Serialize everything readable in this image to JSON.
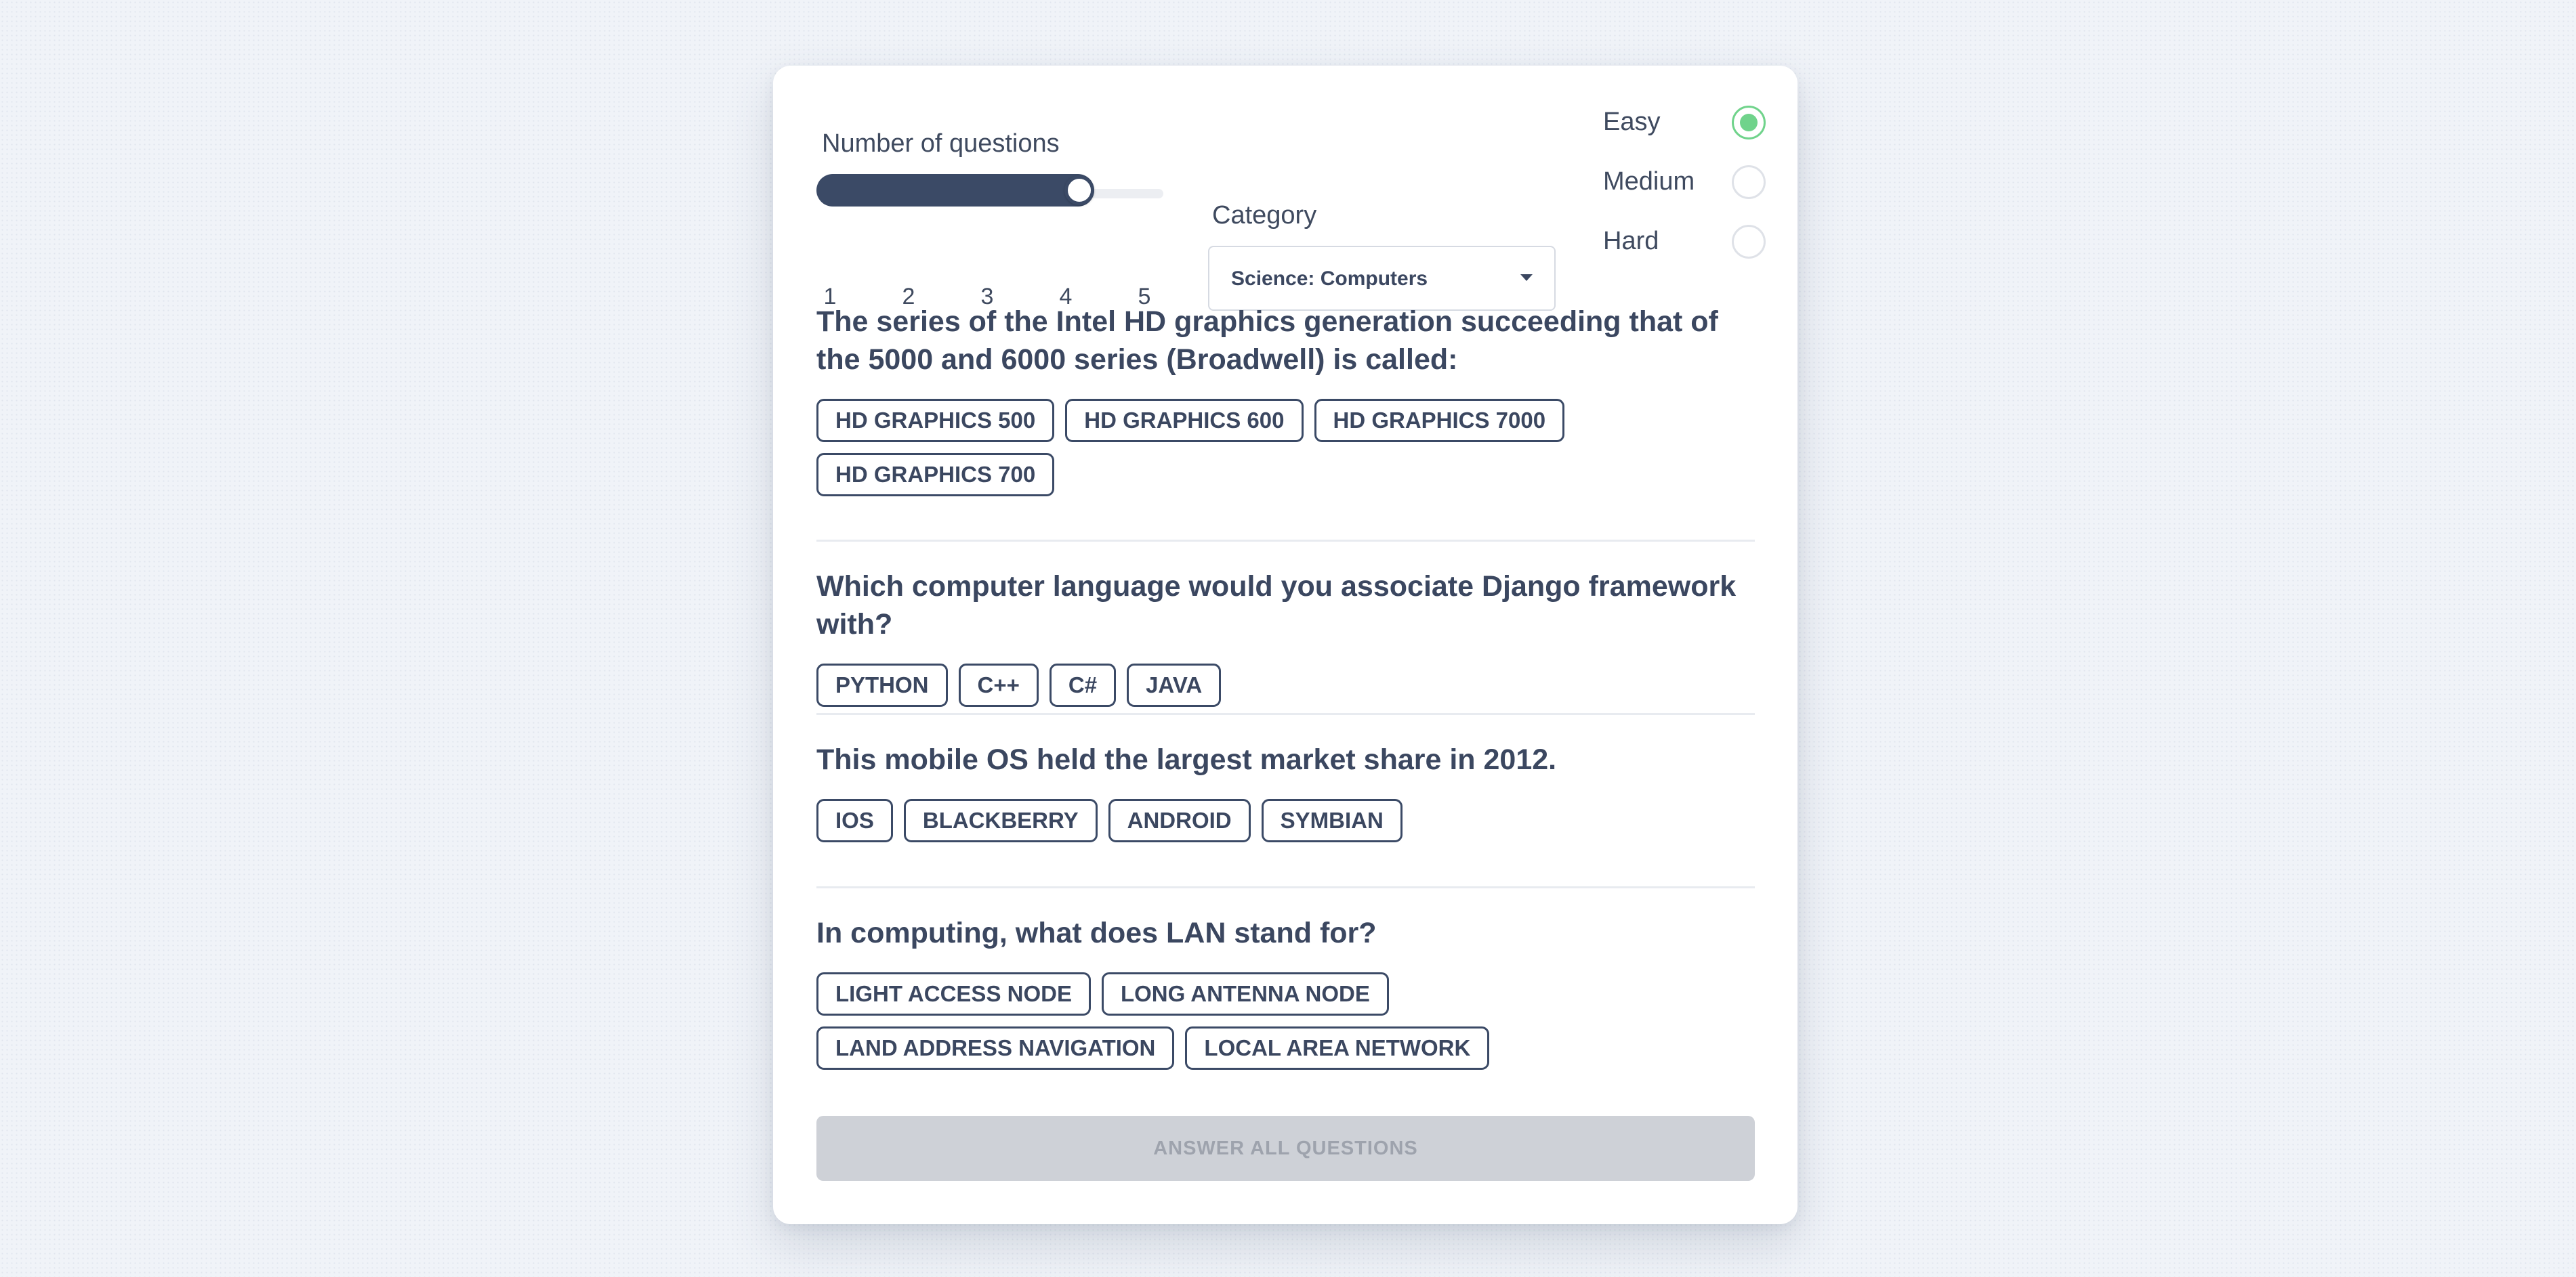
{
  "settings": {
    "number_label": "Number of questions",
    "number_ticks": [
      "1",
      "2",
      "3",
      "4",
      "5"
    ],
    "number_value": 4,
    "number_min": 1,
    "number_max": 5,
    "category_label": "Category",
    "category_value": "Science: Computers",
    "difficulties": [
      {
        "label": "Easy",
        "selected": true
      },
      {
        "label": "Medium",
        "selected": false
      },
      {
        "label": "Hard",
        "selected": false
      }
    ],
    "accent_color": "#70d38b",
    "primary_color": "#3b4a66"
  },
  "questions": [
    {
      "text": "The series of the Intel HD graphics generation succeeding that of the 5000 and 6000 series (Broadwell) is called:",
      "answers": [
        "HD GRAPHICS 500",
        "HD GRAPHICS 600",
        "HD GRAPHICS 7000",
        "HD GRAPHICS 700"
      ]
    },
    {
      "text": "Which computer language would you associate Django framework with?",
      "answers": [
        "PYTHON",
        "C++",
        "C#",
        "JAVA"
      ]
    },
    {
      "text": "This mobile OS held the largest market share in 2012.",
      "answers": [
        "IOS",
        "BLACKBERRY",
        "ANDROID",
        "SYMBIAN"
      ]
    },
    {
      "text": "In computing, what does LAN stand for?",
      "answers": [
        "LIGHT ACCESS NODE",
        "LONG ANTENNA NODE",
        "LAND ADDRESS NAVIGATION",
        "LOCAL AREA NETWORK"
      ]
    }
  ],
  "submit_label": "ANSWER ALL QUESTIONS"
}
